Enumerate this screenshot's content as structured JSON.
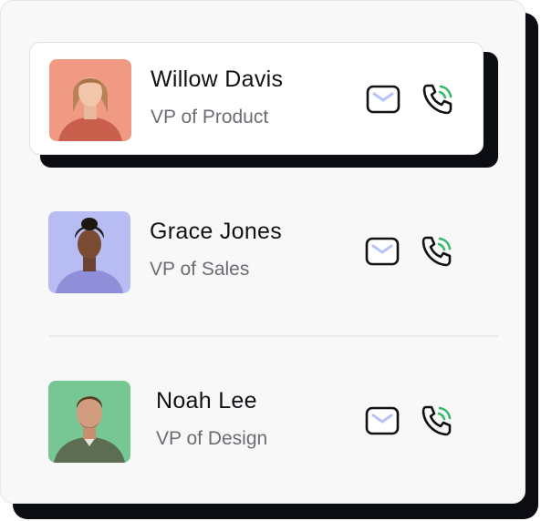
{
  "contacts": [
    {
      "name": "Willow Davis",
      "role": "VP of Product",
      "avatar_bg": "#f09a84",
      "avatar_icon": "woman-portrait",
      "mail_icon": "mail-icon",
      "call_icon": "phone-call-icon"
    },
    {
      "name": "Grace Jones",
      "role": "VP of Sales",
      "avatar_bg": "#b7bdf3",
      "avatar_icon": "woman-portrait",
      "mail_icon": "mail-icon",
      "call_icon": "phone-call-icon"
    },
    {
      "name": "Noah Lee",
      "role": "VP of Design",
      "avatar_bg": "#77c795",
      "avatar_icon": "man-portrait",
      "mail_icon": "mail-icon",
      "call_icon": "phone-call-icon"
    }
  ],
  "colors": {
    "mail_accent": "#b9c2f7",
    "call_wave": "#39b86a",
    "text_primary": "#111216",
    "text_secondary": "#6b6d73"
  }
}
